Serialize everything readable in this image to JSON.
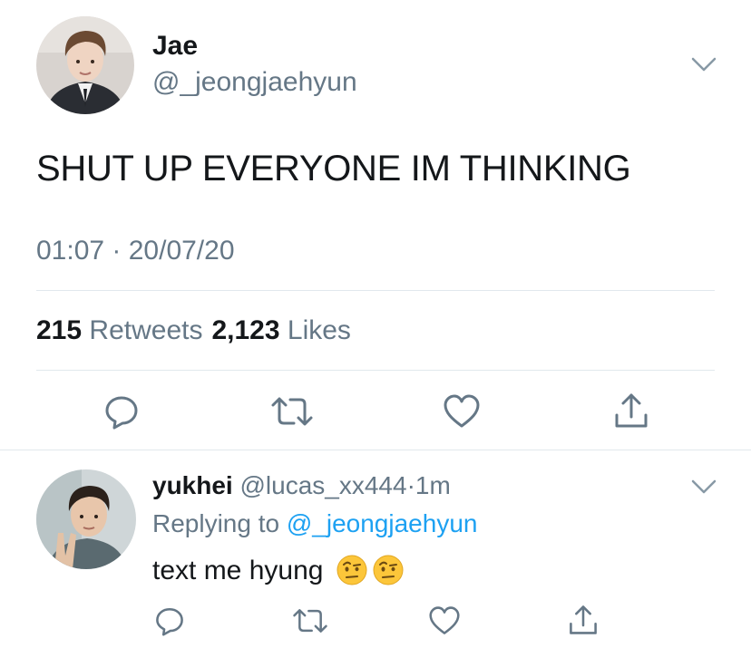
{
  "tweet": {
    "author_name": "Jae",
    "author_handle": "@_jeongjaehyun",
    "text": "SHUT UP EVERYONE IM THINKING",
    "timestamp": "01:07 · 20/07/20",
    "retweet_count": "215",
    "retweet_label": "Retweets",
    "like_count": "2,123",
    "like_label": "Likes",
    "more_icon": "chevron-down-icon"
  },
  "actions": {
    "icons": [
      "reply-icon",
      "retweet-icon",
      "like-icon",
      "share-icon"
    ]
  },
  "reply": {
    "author_name": "yukhei",
    "author_handle": "@lucas_xx444",
    "separator": "·",
    "time": "1m",
    "replying_prefix": "Replying to",
    "replying_to": "@_jeongjaehyun",
    "text": "text me hyung",
    "emojis": [
      "face-with-raised-eyebrow",
      "face-with-raised-eyebrow"
    ]
  },
  "colors": {
    "text_primary": "#14171a",
    "text_secondary": "#657786",
    "link": "#1da1f2",
    "divider": "#e1e8ed"
  }
}
